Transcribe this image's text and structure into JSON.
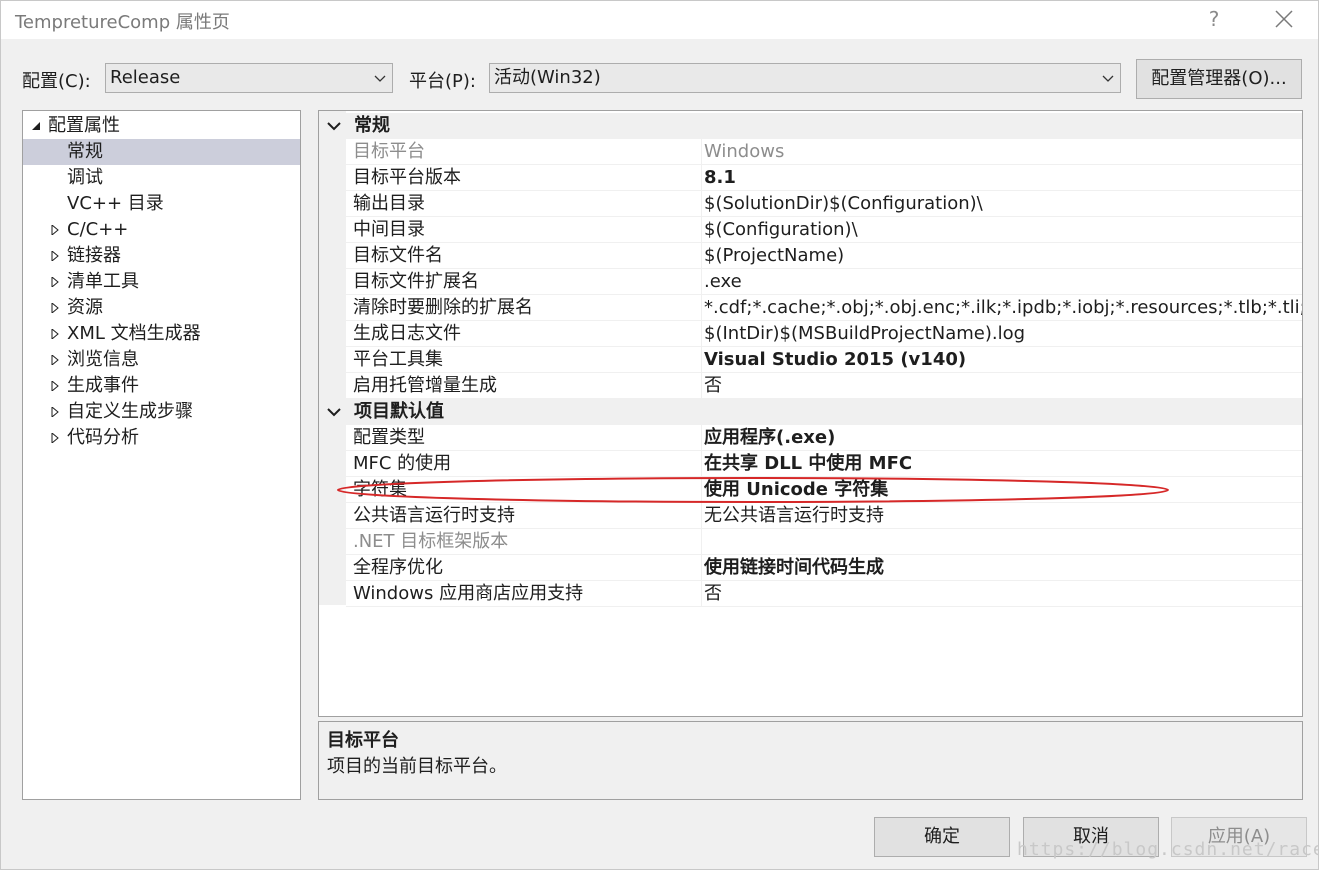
{
  "window": {
    "title": "TempretureComp 属性页",
    "help": "?"
  },
  "toolbar": {
    "config_label": "配置(C):",
    "config_value": "Release",
    "platform_label": "平台(P):",
    "platform_value": "活动(Win32)",
    "config_manager": "配置管理器(O)..."
  },
  "tree": {
    "root": "配置属性",
    "items": [
      {
        "label": "常规",
        "selected": true
      },
      {
        "label": "调试"
      },
      {
        "label": "VC++ 目录"
      },
      {
        "label": "C/C++"
      },
      {
        "label": "链接器"
      },
      {
        "label": "清单工具"
      },
      {
        "label": "资源"
      },
      {
        "label": "XML 文档生成器"
      },
      {
        "label": "浏览信息"
      },
      {
        "label": "生成事件"
      },
      {
        "label": "自定义生成步骤"
      },
      {
        "label": "代码分析"
      }
    ]
  },
  "grid": {
    "sections": [
      {
        "title": "常规",
        "rows": [
          {
            "name": "目标平台",
            "value": "Windows"
          },
          {
            "name": "目标平台版本",
            "value": "8.1"
          },
          {
            "name": "输出目录",
            "value": "$(SolutionDir)$(Configuration)\\"
          },
          {
            "name": "中间目录",
            "value": "$(Configuration)\\"
          },
          {
            "name": "目标文件名",
            "value": "$(ProjectName)"
          },
          {
            "name": "目标文件扩展名",
            "value": ".exe"
          },
          {
            "name": "清除时要删除的扩展名",
            "value": "*.cdf;*.cache;*.obj;*.obj.enc;*.ilk;*.ipdb;*.iobj;*.resources;*.tlb;*.tli;*.tlh;*.t"
          },
          {
            "name": "生成日志文件",
            "value": "$(IntDir)$(MSBuildProjectName).log"
          },
          {
            "name": "平台工具集",
            "value": "Visual Studio 2015 (v140)"
          },
          {
            "name": "启用托管增量生成",
            "value": "否"
          }
        ]
      },
      {
        "title": "项目默认值",
        "rows": [
          {
            "name": "配置类型",
            "value": "应用程序(.exe)"
          },
          {
            "name": "MFC 的使用",
            "value": "在共享 DLL 中使用 MFC"
          },
          {
            "name": "字符集",
            "value": "使用 Unicode 字符集"
          },
          {
            "name": "公共语言运行时支持",
            "value": "无公共语言运行时支持"
          },
          {
            "name": ".NET 目标框架版本",
            "value": ""
          },
          {
            "name": "全程序优化",
            "value": "使用链接时间代码生成"
          },
          {
            "name": "Windows 应用商店应用支持",
            "value": "否"
          }
        ]
      }
    ]
  },
  "description": {
    "title": "目标平台",
    "text": "项目的当前目标平台。"
  },
  "buttons": {
    "ok": "确定",
    "cancel": "取消",
    "apply": "应用(A)"
  },
  "watermark": "https://blog.csdn.net/race_to",
  "colors": {
    "selection": "#cccedb",
    "annotation": "#d62828",
    "disabled_text": "#8d8d8d"
  }
}
